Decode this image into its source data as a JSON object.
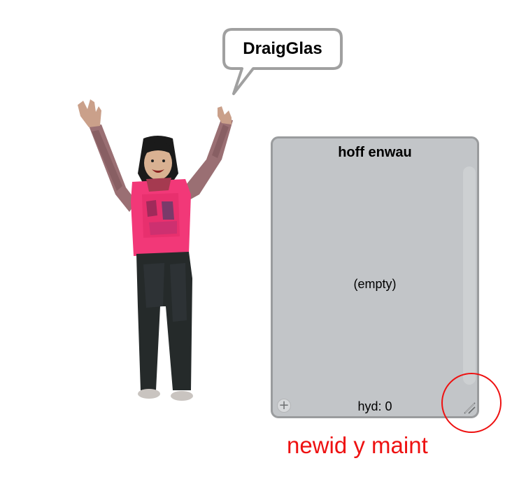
{
  "speech_bubble": {
    "text": "DraigGlas"
  },
  "list_monitor": {
    "title": "hoff enwau",
    "empty_text": "(empty)",
    "length_label": "hyd: 0",
    "add_icon": "plus-icon",
    "resize_icon": "resize-handle-icon"
  },
  "annotation": {
    "label": "newid y maint",
    "color": "#ee1111"
  },
  "colors": {
    "monitor_bg": "#c2c5c8",
    "monitor_border": "#9a9c9e",
    "bubble_border": "#a0a0a0"
  }
}
